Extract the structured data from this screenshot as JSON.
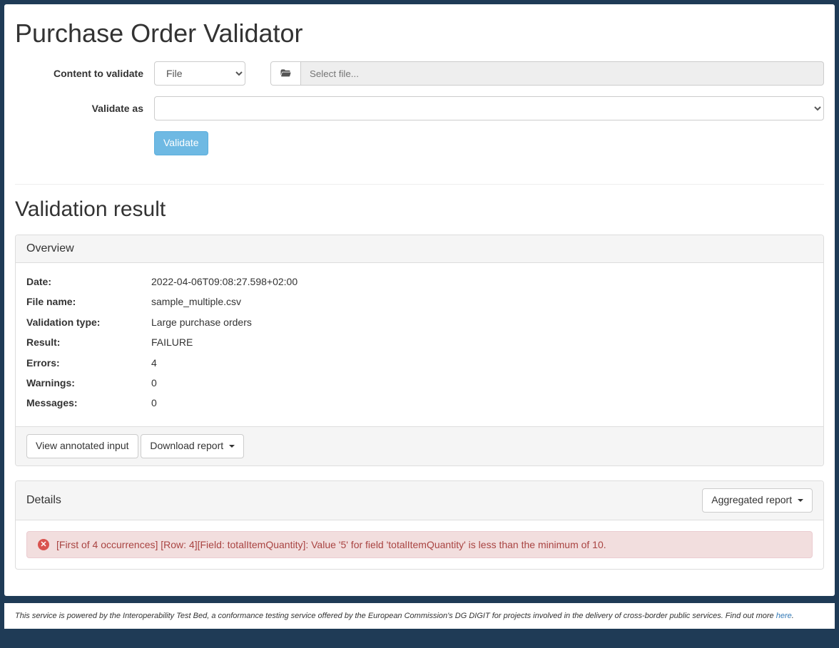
{
  "page_title": "Purchase Order Validator",
  "form": {
    "content_label": "Content to validate",
    "content_type_value": "File",
    "file_placeholder": "Select file...",
    "validate_as_label": "Validate as",
    "validate_button": "Validate"
  },
  "result_heading": "Validation result",
  "overview": {
    "heading": "Overview",
    "rows": {
      "date_label": "Date:",
      "date_value": "2022-04-06T09:08:27.598+02:00",
      "filename_label": "File name:",
      "filename_value": "sample_multiple.csv",
      "type_label": "Validation type:",
      "type_value": "Large purchase orders",
      "result_label": "Result:",
      "result_value": "FAILURE",
      "errors_label": "Errors:",
      "errors_value": "4",
      "warnings_label": "Warnings:",
      "warnings_value": "0",
      "messages_label": "Messages:",
      "messages_value": "0"
    },
    "view_annotated": "View annotated input",
    "download_report": "Download report"
  },
  "details": {
    "heading": "Details",
    "aggregated_label": "Aggregated report",
    "error_text": "[First of 4 occurrences] [Row: 4][Field: totalItemQuantity]: Value '5' for field 'totalItemQuantity' is less than the minimum of 10."
  },
  "footer": {
    "text": "This service is powered by the Interoperability Test Bed, a conformance testing service offered by the European Commission's DG DIGIT for projects involved in the delivery of cross-border public services. Find out more ",
    "link": "here",
    "suffix": "."
  }
}
